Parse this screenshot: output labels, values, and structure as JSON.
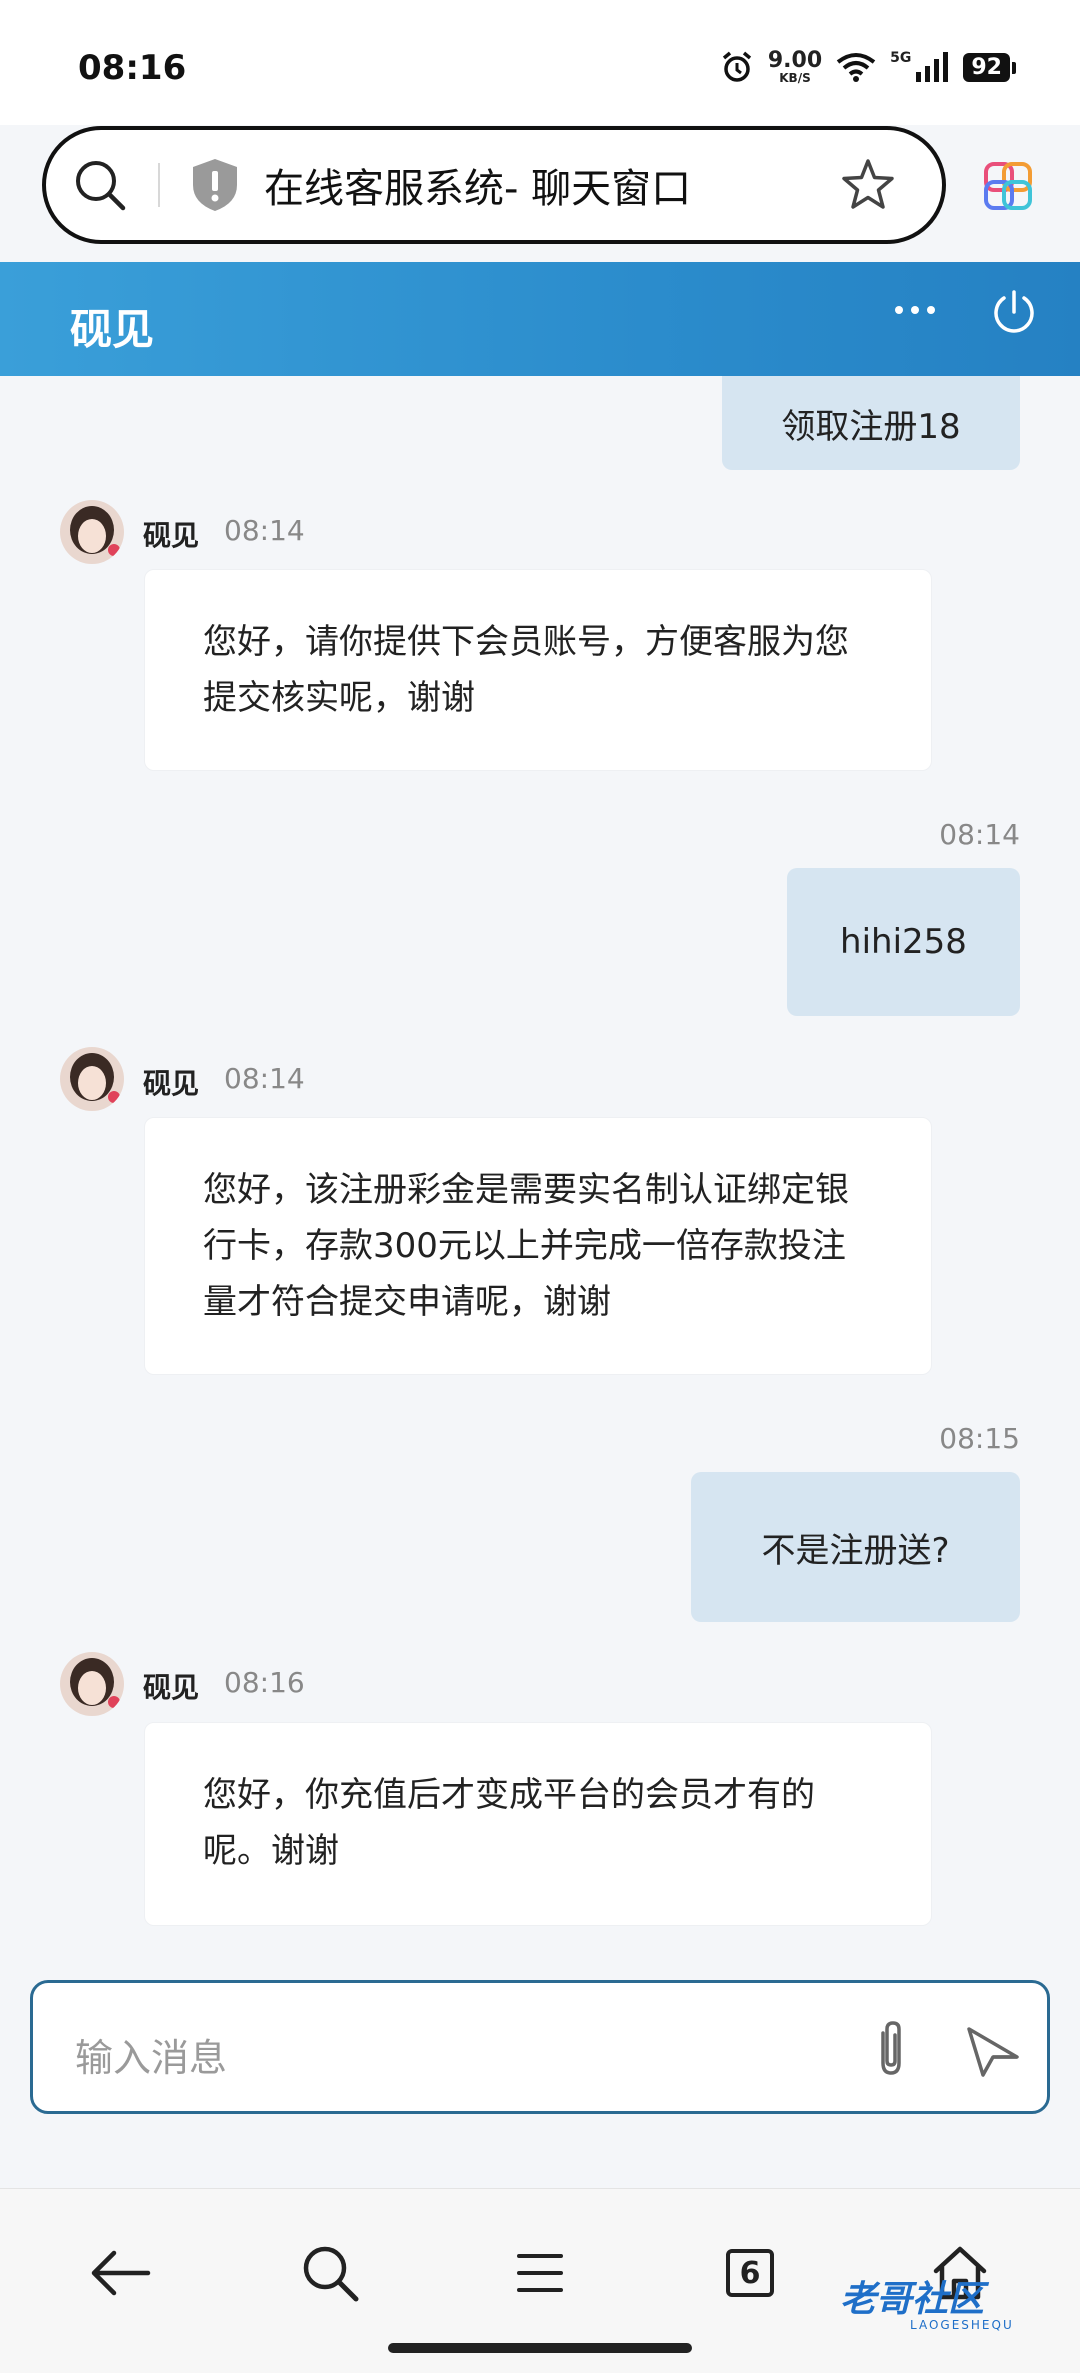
{
  "status_bar": {
    "time": "08:16",
    "net_speed_value": "9.00",
    "net_speed_unit": "KB/S",
    "network": "5G",
    "battery": "92"
  },
  "browser": {
    "page_title": "在线客服系统- 聊天窗口",
    "tab_count": "6"
  },
  "chat": {
    "title": "砚见",
    "colors": {
      "header": "#2b8ccc",
      "user_bubble": "#d6e5f1",
      "agent_bubble": "#ffffff"
    },
    "messages": [
      {
        "from": "user",
        "text": "领取注册18"
      },
      {
        "from": "agent",
        "name": "砚见",
        "time": "08:14",
        "lines": [
          "您好，请你提供下会员账号，方便客服为您",
          "提交核实呢，谢谢"
        ]
      },
      {
        "from": "user",
        "time": "08:14",
        "text": "hihi258"
      },
      {
        "from": "agent",
        "name": "砚见",
        "time": "08:14",
        "lines": [
          "您好，该注册彩金是需要实名制认证绑定银",
          "行卡，存款300元以上并完成一倍存款投注",
          "量才符合提交申请呢，谢谢"
        ]
      },
      {
        "from": "user",
        "time": "08:15",
        "text": "不是注册送?"
      },
      {
        "from": "agent",
        "name": "砚见",
        "time": "08:16",
        "lines": [
          "您好，你充值后才变成平台的会员才有的",
          "呢。谢谢"
        ]
      }
    ]
  },
  "input": {
    "placeholder": "输入消息"
  },
  "icons": [
    "alarm-icon",
    "wifi-icon",
    "signal-icon",
    "search-icon",
    "shield-icon",
    "star-icon",
    "extension-icon",
    "more-icon",
    "power-icon",
    "attach-icon",
    "send-icon",
    "back-icon",
    "menu-icon",
    "home-icon"
  ],
  "watermark": {
    "text": "老哥社区",
    "sub": "LAOGESHEQU"
  }
}
